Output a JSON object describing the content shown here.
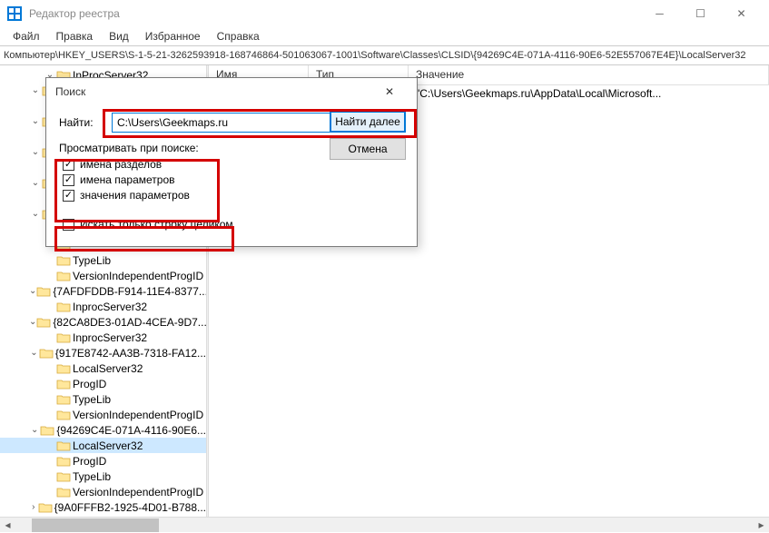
{
  "window": {
    "title": "Редактор реестра",
    "menu": [
      "Файл",
      "Правка",
      "Вид",
      "Избранное",
      "Справка"
    ],
    "address": "Компьютер\\HKEY_USERS\\S-1-5-21-3262593918-168746864-501063067-1001\\Software\\Classes\\CLSID\\{94269C4E-071A-4116-90E6-52E557067E4E}\\LocalServer32"
  },
  "list": {
    "headers": [
      "Имя",
      "Тип",
      "Значение"
    ],
    "value": "\"C:\\Users\\Geekmaps.ru\\AppData\\Local\\Microsoft..."
  },
  "tree": [
    {
      "indent": 3,
      "exp": "open",
      "label": "InProcServer32"
    },
    {
      "indent": 2,
      "exp": "open",
      "label": ""
    },
    {
      "indent": 3,
      "exp": "none",
      "label": ""
    },
    {
      "indent": 2,
      "exp": "open",
      "label": ""
    },
    {
      "indent": 3,
      "exp": "none",
      "label": ""
    },
    {
      "indent": 2,
      "exp": "open",
      "label": ""
    },
    {
      "indent": 3,
      "exp": "none",
      "label": ""
    },
    {
      "indent": 2,
      "exp": "open",
      "label": ""
    },
    {
      "indent": 3,
      "exp": "none",
      "label": ""
    },
    {
      "indent": 2,
      "exp": "open",
      "label": ""
    },
    {
      "indent": 3,
      "exp": "none",
      "label": ""
    },
    {
      "indent": 3,
      "exp": "none",
      "label": ""
    },
    {
      "indent": 3,
      "exp": "none",
      "label": "TypeLib"
    },
    {
      "indent": 3,
      "exp": "none",
      "label": "VersionIndependentProgID"
    },
    {
      "indent": 2,
      "exp": "open",
      "label": "{7AFDFDDB-F914-11E4-8377..."
    },
    {
      "indent": 3,
      "exp": "none",
      "label": "InprocServer32"
    },
    {
      "indent": 2,
      "exp": "open",
      "label": "{82CA8DE3-01AD-4CEA-9D7..."
    },
    {
      "indent": 3,
      "exp": "none",
      "label": "InprocServer32"
    },
    {
      "indent": 2,
      "exp": "open",
      "label": "{917E8742-AA3B-7318-FA12..."
    },
    {
      "indent": 3,
      "exp": "none",
      "label": "LocalServer32"
    },
    {
      "indent": 3,
      "exp": "none",
      "label": "ProgID"
    },
    {
      "indent": 3,
      "exp": "none",
      "label": "TypeLib"
    },
    {
      "indent": 3,
      "exp": "none",
      "label": "VersionIndependentProgID"
    },
    {
      "indent": 2,
      "exp": "open",
      "label": "{94269C4E-071A-4116-90E6..."
    },
    {
      "indent": 3,
      "exp": "none",
      "label": "LocalServer32",
      "sel": true
    },
    {
      "indent": 3,
      "exp": "none",
      "label": "ProgID"
    },
    {
      "indent": 3,
      "exp": "none",
      "label": "TypeLib"
    },
    {
      "indent": 3,
      "exp": "none",
      "label": "VersionIndependentProgID"
    },
    {
      "indent": 2,
      "exp": "closed",
      "label": "{9A0FFFB2-1925-4D01-B788..."
    }
  ],
  "dialog": {
    "title": "Поиск",
    "find_label": "Найти:",
    "find_value": "C:\\Users\\Geekmaps.ru",
    "btn_next": "Найти далее",
    "btn_cancel": "Отмена",
    "group": "Просматривать при поиске:",
    "opts": [
      {
        "label": "имена разделов",
        "checked": true,
        "underline": "р"
      },
      {
        "label": "имена параметров",
        "checked": true,
        "underline": "п"
      },
      {
        "label": "значения параметров",
        "checked": true,
        "underline": "з"
      }
    ],
    "whole": {
      "label": "Искать только строку целиком",
      "checked": false
    }
  }
}
